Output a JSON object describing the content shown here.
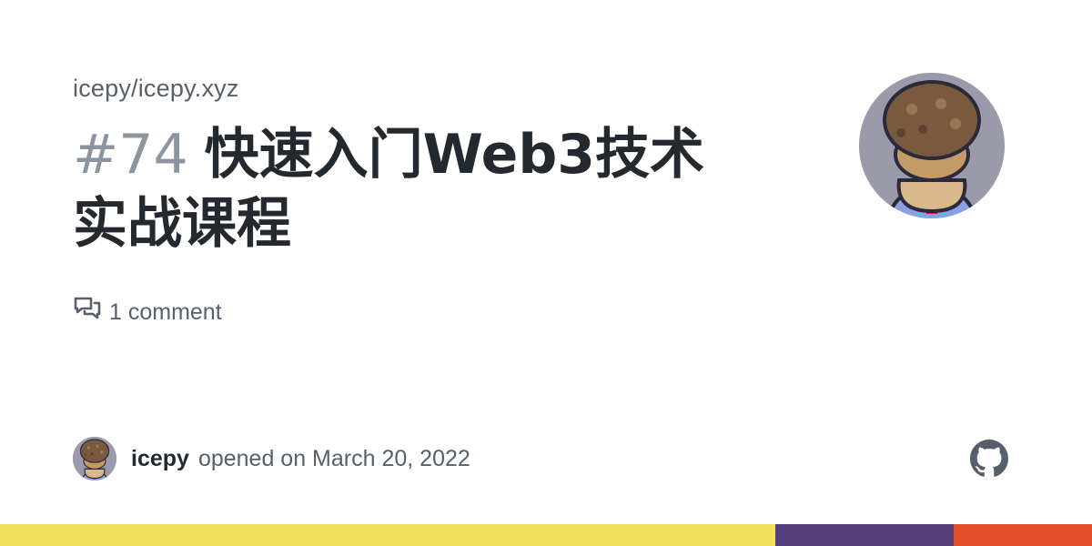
{
  "repo": {
    "full_name": "icepy/icepy.xyz"
  },
  "issue": {
    "number": "#74",
    "title": "快速入门Web3技术实战课程"
  },
  "meta": {
    "comments": "1 comment"
  },
  "author": {
    "name": "icepy",
    "opened_text": "opened on March 20, 2022"
  },
  "icons": {
    "comment": "comment-discussion-icon",
    "brand": "github-mark-icon",
    "avatar": "pixel-monkey-avatar"
  },
  "colors": {
    "title": "#24292f",
    "muted": "#57606a",
    "number": "#8c959f",
    "avatar_bg": "#9a9aaa",
    "language_bar": [
      "#f1e05a",
      "#563d7c",
      "#e34c26"
    ]
  },
  "language_bar": [
    {
      "color": "#f1e05a",
      "share": 0.71
    },
    {
      "color": "#563d7c",
      "share": 0.163
    },
    {
      "color": "#e34c26",
      "share": 0.127
    }
  ]
}
